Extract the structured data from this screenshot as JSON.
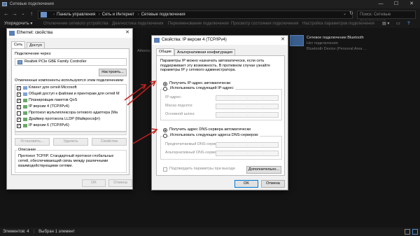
{
  "explorer": {
    "title": "Сетевые подключения",
    "address": {
      "crumbs": [
        "Панель управления",
        "Сеть и Интернет",
        "Сетевые подключения"
      ]
    },
    "search_placeholder": "Поиск: Сетевые подключения",
    "commands": {
      "organize": "Упорядочить ▾",
      "disable": "Отключение сетевого устройства",
      "diagnose": "Диагностика подключения",
      "rename": "Переименование подключения",
      "status": "Просмотр состояния подключения",
      "settings": "Настройка параметров подключения"
    },
    "items": {
      "ethernet_adapter": "Atheros Cs",
      "bt_title": "Сетевое подключение Bluetooth",
      "bt_status": "Нет подключения",
      "bt_device": "Bluetooth Device (Personal Area ..."
    },
    "status": {
      "count": "Элементов: 4",
      "selected": "Выбран 1 элемент"
    }
  },
  "ethernet_dialog": {
    "title": "Ethernet: свойства",
    "tabs": [
      "Сеть",
      "Доступ"
    ],
    "connect_via_label": "Подключение через:",
    "adapter_name": "Realtek PCIe GBE Family Controller",
    "configure_button": "Настроить...",
    "components_label": "Отмеченные компоненты используются этим подключением:",
    "components": [
      {
        "label": "Клиент для сетей Microsoft",
        "checked": true
      },
      {
        "label": "Общий доступ к файлам и принтерам для сетей M",
        "checked": true
      },
      {
        "label": "Планировщик пакетов QoS",
        "checked": true
      },
      {
        "label": "IP версии 4 (TCP/IPv4)",
        "checked": true
      },
      {
        "label": "Протокол мультиплексора сетевого адаптера (Ma",
        "checked": false
      },
      {
        "label": "Драйвер протокола LLDP (Майкрософт)",
        "checked": true
      },
      {
        "label": "IP версии 6 (TCP/IPv6)",
        "checked": true
      }
    ],
    "install_button": "Установить...",
    "remove_button": "Удалить",
    "properties_button": "Свойства",
    "description_title": "Описание",
    "description_text": "Протокол TCP/IP. Стандартный протокол глобальных сетей, обеспечивающий связь между различными взаимодействующими сетями.",
    "ok_button": "OK",
    "cancel_button": "Отмена"
  },
  "ipv4_dialog": {
    "title": "Свойства: IP версии 4 (TCP/IPv4)",
    "tabs": [
      "Общие",
      "Альтернативная конфигурация"
    ],
    "intro": "Параметры IP можно назначать автоматически, если сеть поддерживает эту возможность. В противном случае узнайте параметры IP у сетевого администратора.",
    "ip_auto": "Получить IP-адрес автоматически",
    "ip_manual": "Использовать следующий IP-адрес:",
    "ip_address_label": "IP-адрес:",
    "subnet_label": "Маска подсети:",
    "gateway_label": "Основной шлюз:",
    "dns_auto": "Получить адрес DNS-сервера автоматически",
    "dns_manual": "Использовать следующие адреса DNS-серверов:",
    "preferred_dns_label": "Предпочитаемый DNS-сервер:",
    "alternate_dns_label": "Альтернативный DNS-сервер:",
    "validate_label": "Подтвердить параметры при выходе",
    "advanced_button": "Дополнительно...",
    "ok_button": "OK",
    "cancel_button": "Отмена"
  },
  "colors": {
    "arrow": "#c81e1e",
    "accent": "#0078d7"
  }
}
